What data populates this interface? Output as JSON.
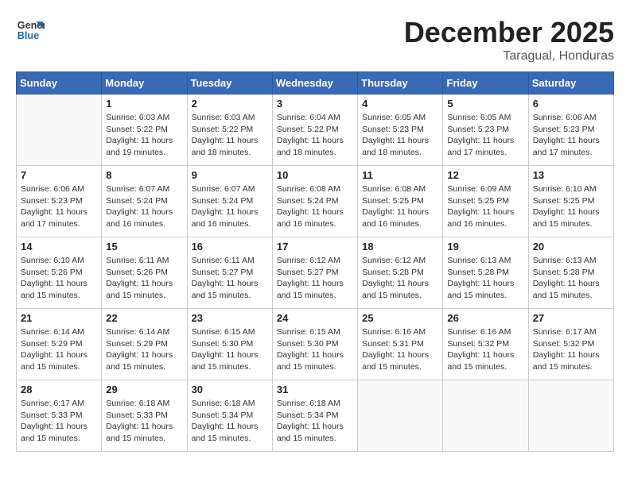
{
  "logo": {
    "line1": "General",
    "line2": "Blue"
  },
  "title": {
    "month_year": "December 2025",
    "location": "Taragual, Honduras"
  },
  "days_of_week": [
    "Sunday",
    "Monday",
    "Tuesday",
    "Wednesday",
    "Thursday",
    "Friday",
    "Saturday"
  ],
  "weeks": [
    [
      {
        "day": "",
        "info": ""
      },
      {
        "day": "1",
        "info": "Sunrise: 6:03 AM\nSunset: 5:22 PM\nDaylight: 11 hours\nand 19 minutes."
      },
      {
        "day": "2",
        "info": "Sunrise: 6:03 AM\nSunset: 5:22 PM\nDaylight: 11 hours\nand 18 minutes."
      },
      {
        "day": "3",
        "info": "Sunrise: 6:04 AM\nSunset: 5:22 PM\nDaylight: 11 hours\nand 18 minutes."
      },
      {
        "day": "4",
        "info": "Sunrise: 6:05 AM\nSunset: 5:23 PM\nDaylight: 11 hours\nand 18 minutes."
      },
      {
        "day": "5",
        "info": "Sunrise: 6:05 AM\nSunset: 5:23 PM\nDaylight: 11 hours\nand 17 minutes."
      },
      {
        "day": "6",
        "info": "Sunrise: 6:06 AM\nSunset: 5:23 PM\nDaylight: 11 hours\nand 17 minutes."
      }
    ],
    [
      {
        "day": "7",
        "info": "Sunrise: 6:06 AM\nSunset: 5:23 PM\nDaylight: 11 hours\nand 17 minutes."
      },
      {
        "day": "8",
        "info": "Sunrise: 6:07 AM\nSunset: 5:24 PM\nDaylight: 11 hours\nand 16 minutes."
      },
      {
        "day": "9",
        "info": "Sunrise: 6:07 AM\nSunset: 5:24 PM\nDaylight: 11 hours\nand 16 minutes."
      },
      {
        "day": "10",
        "info": "Sunrise: 6:08 AM\nSunset: 5:24 PM\nDaylight: 11 hours\nand 16 minutes."
      },
      {
        "day": "11",
        "info": "Sunrise: 6:08 AM\nSunset: 5:25 PM\nDaylight: 11 hours\nand 16 minutes."
      },
      {
        "day": "12",
        "info": "Sunrise: 6:09 AM\nSunset: 5:25 PM\nDaylight: 11 hours\nand 16 minutes."
      },
      {
        "day": "13",
        "info": "Sunrise: 6:10 AM\nSunset: 5:25 PM\nDaylight: 11 hours\nand 15 minutes."
      }
    ],
    [
      {
        "day": "14",
        "info": "Sunrise: 6:10 AM\nSunset: 5:26 PM\nDaylight: 11 hours\nand 15 minutes."
      },
      {
        "day": "15",
        "info": "Sunrise: 6:11 AM\nSunset: 5:26 PM\nDaylight: 11 hours\nand 15 minutes."
      },
      {
        "day": "16",
        "info": "Sunrise: 6:11 AM\nSunset: 5:27 PM\nDaylight: 11 hours\nand 15 minutes."
      },
      {
        "day": "17",
        "info": "Sunrise: 6:12 AM\nSunset: 5:27 PM\nDaylight: 11 hours\nand 15 minutes."
      },
      {
        "day": "18",
        "info": "Sunrise: 6:12 AM\nSunset: 5:28 PM\nDaylight: 11 hours\nand 15 minutes."
      },
      {
        "day": "19",
        "info": "Sunrise: 6:13 AM\nSunset: 5:28 PM\nDaylight: 11 hours\nand 15 minutes."
      },
      {
        "day": "20",
        "info": "Sunrise: 6:13 AM\nSunset: 5:28 PM\nDaylight: 11 hours\nand 15 minutes."
      }
    ],
    [
      {
        "day": "21",
        "info": "Sunrise: 6:14 AM\nSunset: 5:29 PM\nDaylight: 11 hours\nand 15 minutes."
      },
      {
        "day": "22",
        "info": "Sunrise: 6:14 AM\nSunset: 5:29 PM\nDaylight: 11 hours\nand 15 minutes."
      },
      {
        "day": "23",
        "info": "Sunrise: 6:15 AM\nSunset: 5:30 PM\nDaylight: 11 hours\nand 15 minutes."
      },
      {
        "day": "24",
        "info": "Sunrise: 6:15 AM\nSunset: 5:30 PM\nDaylight: 11 hours\nand 15 minutes."
      },
      {
        "day": "25",
        "info": "Sunrise: 6:16 AM\nSunset: 5:31 PM\nDaylight: 11 hours\nand 15 minutes."
      },
      {
        "day": "26",
        "info": "Sunrise: 6:16 AM\nSunset: 5:32 PM\nDaylight: 11 hours\nand 15 minutes."
      },
      {
        "day": "27",
        "info": "Sunrise: 6:17 AM\nSunset: 5:32 PM\nDaylight: 11 hours\nand 15 minutes."
      }
    ],
    [
      {
        "day": "28",
        "info": "Sunrise: 6:17 AM\nSunset: 5:33 PM\nDaylight: 11 hours\nand 15 minutes."
      },
      {
        "day": "29",
        "info": "Sunrise: 6:18 AM\nSunset: 5:33 PM\nDaylight: 11 hours\nand 15 minutes."
      },
      {
        "day": "30",
        "info": "Sunrise: 6:18 AM\nSunset: 5:34 PM\nDaylight: 11 hours\nand 15 minutes."
      },
      {
        "day": "31",
        "info": "Sunrise: 6:18 AM\nSunset: 5:34 PM\nDaylight: 11 hours\nand 15 minutes."
      },
      {
        "day": "",
        "info": ""
      },
      {
        "day": "",
        "info": ""
      },
      {
        "day": "",
        "info": ""
      }
    ]
  ]
}
